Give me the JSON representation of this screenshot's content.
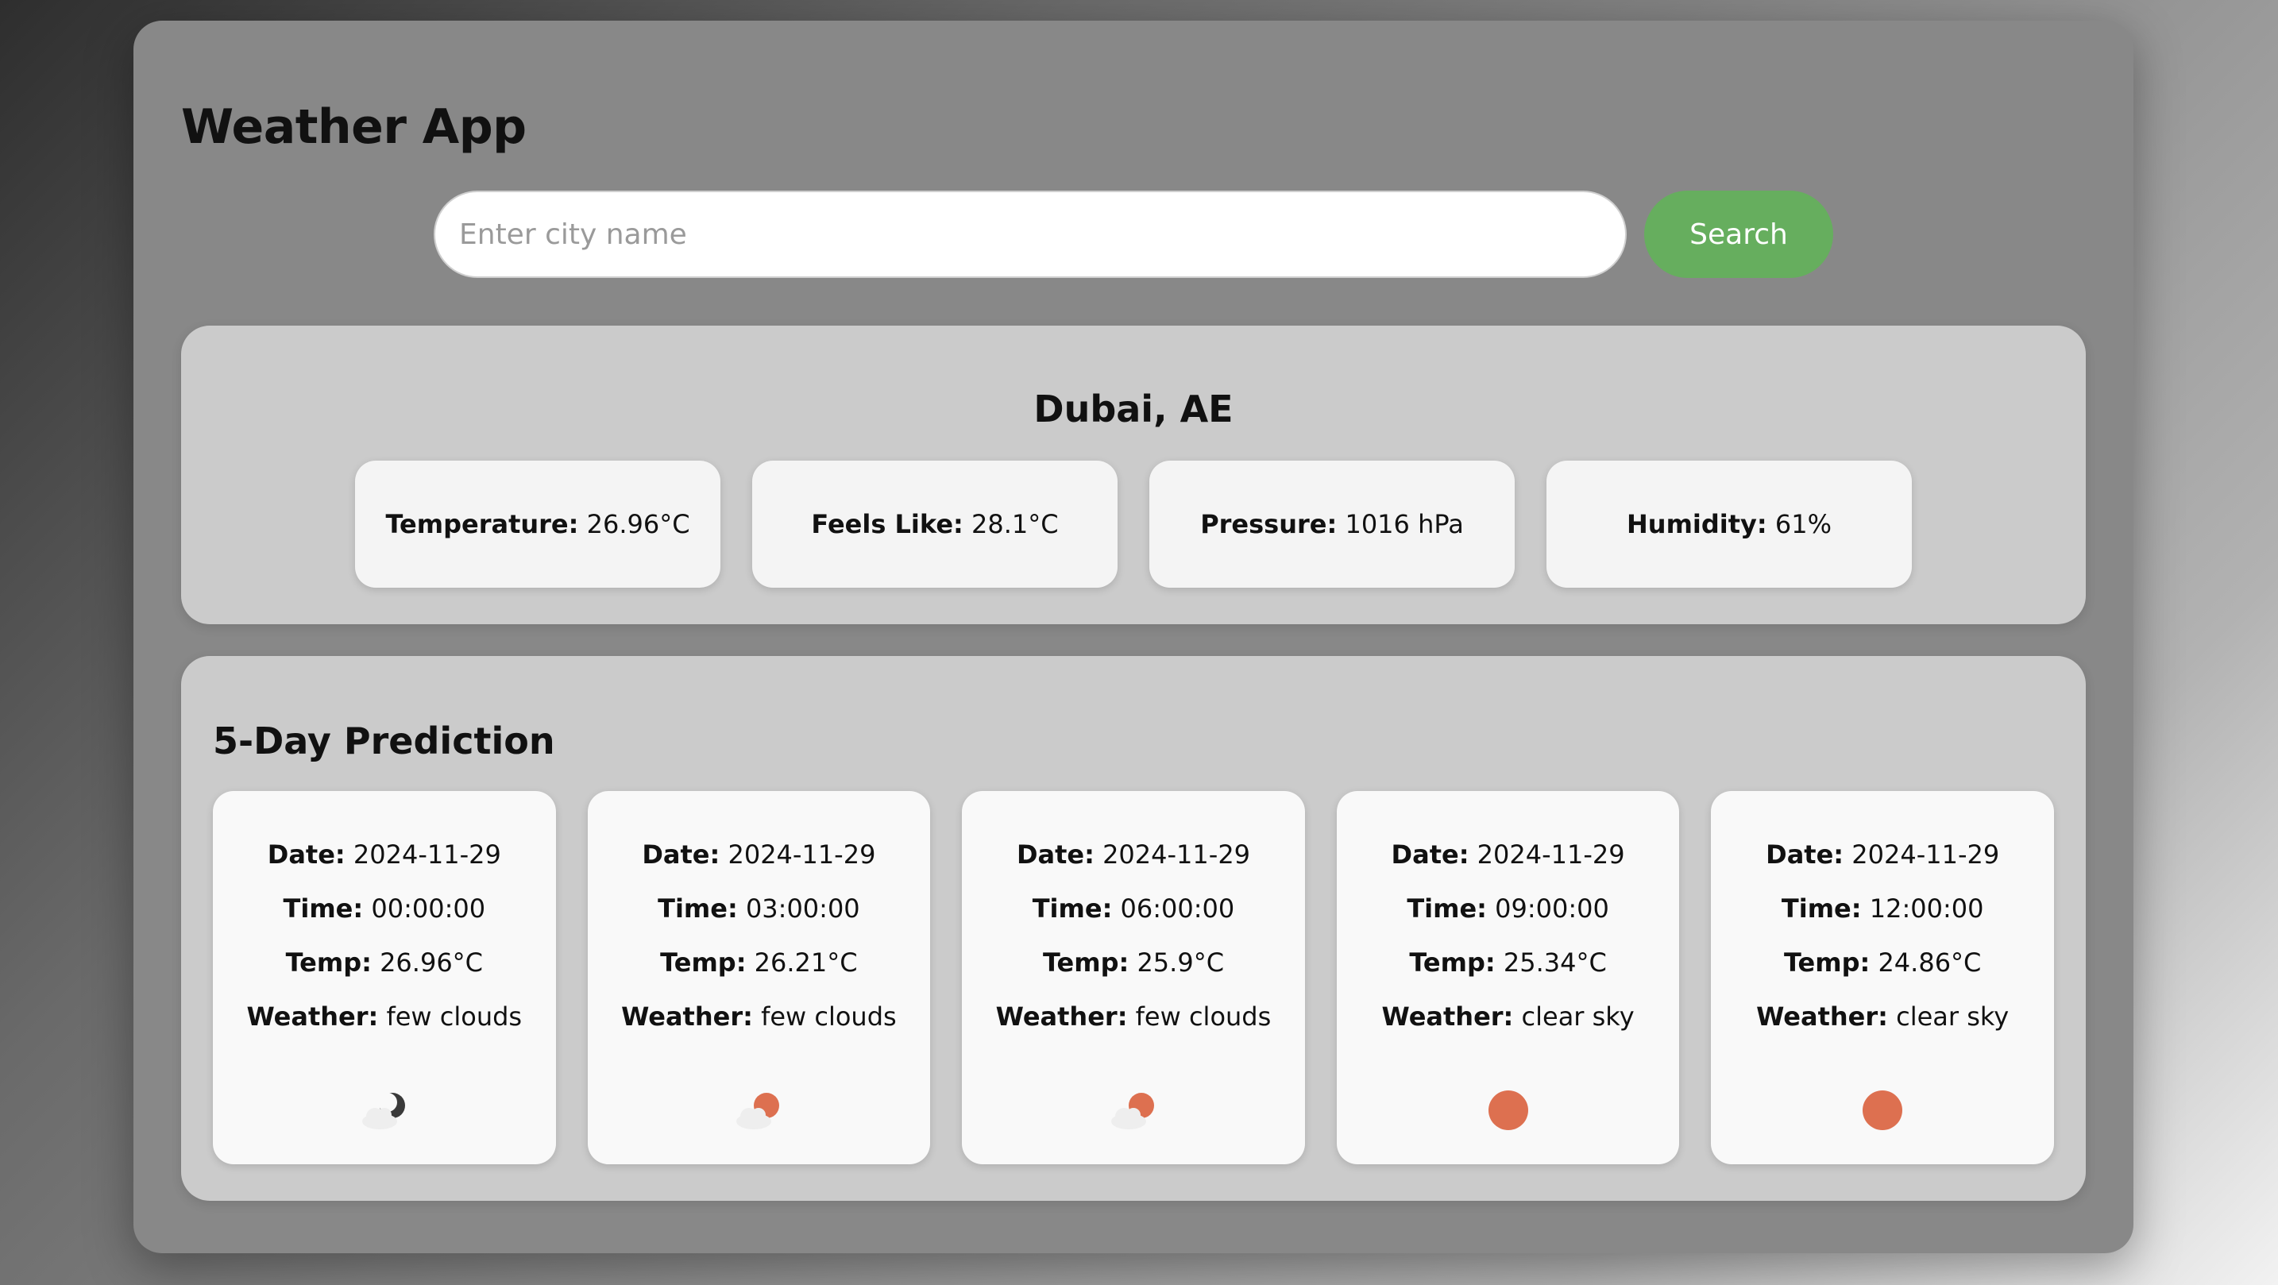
{
  "app": {
    "title": "Weather App"
  },
  "search": {
    "placeholder": "Enter city name",
    "value": "",
    "button_label": "Search",
    "button_color": "#66ae5e"
  },
  "current": {
    "city": "Dubai, AE",
    "metrics": [
      {
        "label": "Temperature:",
        "value": "26.96°C"
      },
      {
        "label": "Feels Like:",
        "value": "28.1°C"
      },
      {
        "label": "Pressure:",
        "value": "1016 hPa"
      },
      {
        "label": "Humidity:",
        "value": "61%"
      }
    ]
  },
  "forecast": {
    "title": "5-Day Prediction",
    "labels": {
      "date": "Date:",
      "time": "Time:",
      "temp": "Temp:",
      "weather": "Weather:"
    },
    "days": [
      {
        "date": "2024-11-29",
        "time": "00:00:00",
        "temp": "26.96°C",
        "weather": "few clouds",
        "icon": "few-clouds-night-icon"
      },
      {
        "date": "2024-11-29",
        "time": "03:00:00",
        "temp": "26.21°C",
        "weather": "few clouds",
        "icon": "few-clouds-day-icon"
      },
      {
        "date": "2024-11-29",
        "time": "06:00:00",
        "temp": "25.9°C",
        "weather": "few clouds",
        "icon": "few-clouds-day-icon"
      },
      {
        "date": "2024-11-29",
        "time": "09:00:00",
        "temp": "25.34°C",
        "weather": "clear sky",
        "icon": "clear-sky-sun-icon"
      },
      {
        "date": "2024-11-29",
        "time": "12:00:00",
        "temp": "24.86°C",
        "weather": "clear sky",
        "icon": "clear-sky-sun-icon"
      }
    ]
  },
  "colors": {
    "sun": "#dd7050",
    "moon": "#3a3a3a",
    "cloud": "#eeeeee"
  }
}
